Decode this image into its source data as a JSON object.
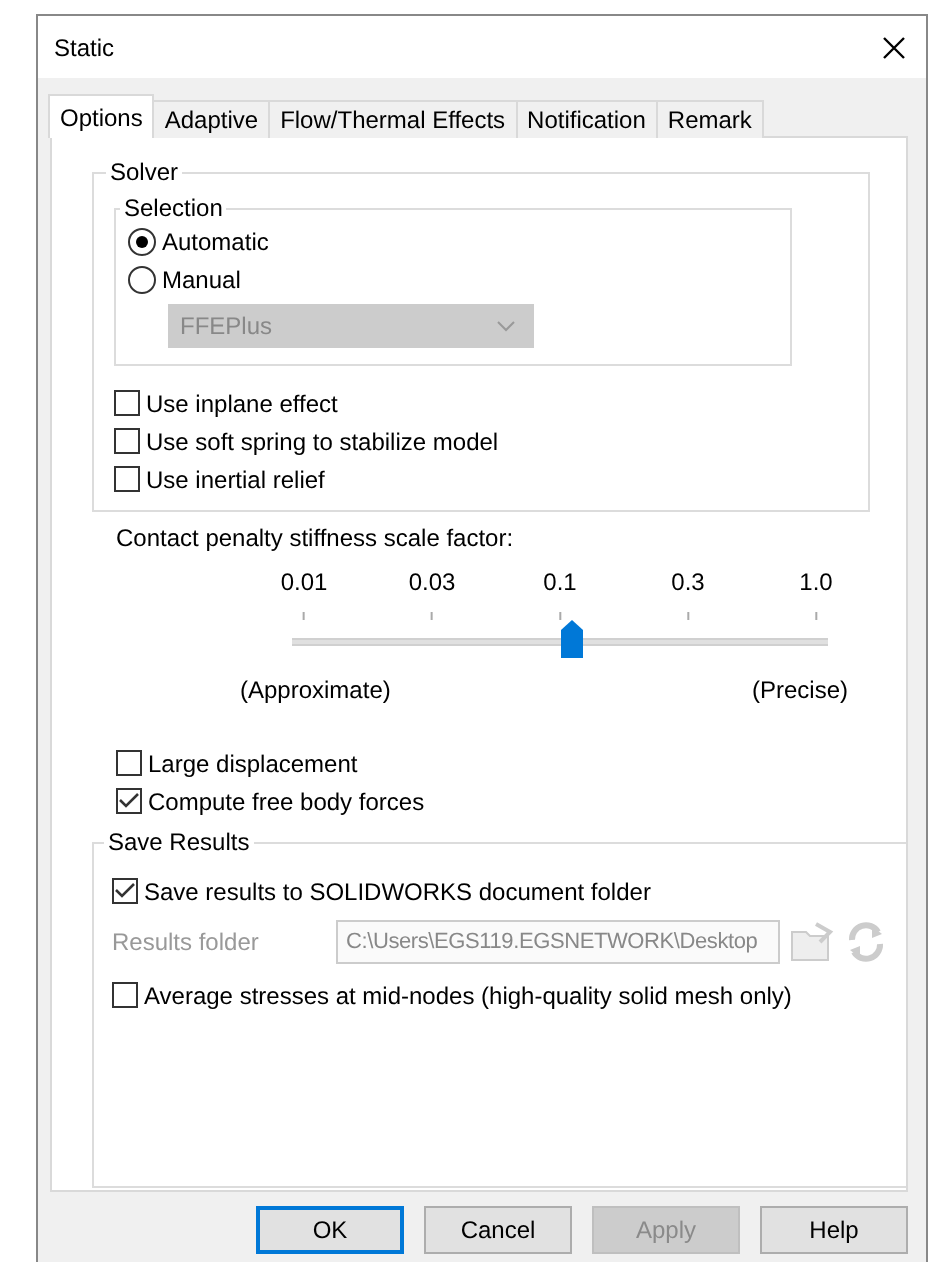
{
  "window": {
    "title": "Static"
  },
  "tabs": [
    {
      "label": "Options",
      "selected": true
    },
    {
      "label": "Adaptive",
      "selected": false
    },
    {
      "label": "Flow/Thermal Effects",
      "selected": false
    },
    {
      "label": "Notification",
      "selected": false
    },
    {
      "label": "Remark",
      "selected": false
    }
  ],
  "solver": {
    "title": "Solver",
    "selection": {
      "title": "Selection",
      "options": [
        {
          "label": "Automatic",
          "selected": true
        },
        {
          "label": "Manual",
          "selected": false
        }
      ],
      "dropdown": {
        "value": "FFEPlus",
        "disabled": true
      }
    },
    "checkboxes": [
      {
        "label": "Use inplane effect",
        "checked": false
      },
      {
        "label": "Use soft spring to stabilize model",
        "checked": false
      },
      {
        "label": "Use inertial relief",
        "checked": false
      }
    ]
  },
  "stiffness": {
    "label": "Contact penalty stiffness scale factor:",
    "ticks": [
      "0.01",
      "0.03",
      "0.1",
      "0.3",
      "1.0"
    ],
    "level": 0.5,
    "min_label": "(Approximate)",
    "max_label": "(Precise)"
  },
  "options": [
    {
      "label": "Large displacement",
      "checked": false
    },
    {
      "label": "Compute free body forces",
      "checked": true
    }
  ],
  "save_results": {
    "title": "Save Results",
    "save_to_doc": {
      "label": "Save results to SOLIDWORKS document folder",
      "checked": true
    },
    "folder": {
      "label": "Results folder",
      "value": "C:\\Users\\EGS119.EGSNETWORK\\Desktop",
      "disabled": true
    },
    "average": {
      "label": "Average stresses at mid-nodes (high-quality solid mesh only)",
      "checked": false
    }
  },
  "buttons": [
    {
      "label": "OK",
      "kind": "default",
      "disabled": false
    },
    {
      "label": "Cancel",
      "kind": "normal",
      "disabled": false
    },
    {
      "label": "Apply",
      "kind": "normal",
      "disabled": true
    },
    {
      "label": "Help",
      "kind": "normal",
      "disabled": false
    }
  ]
}
